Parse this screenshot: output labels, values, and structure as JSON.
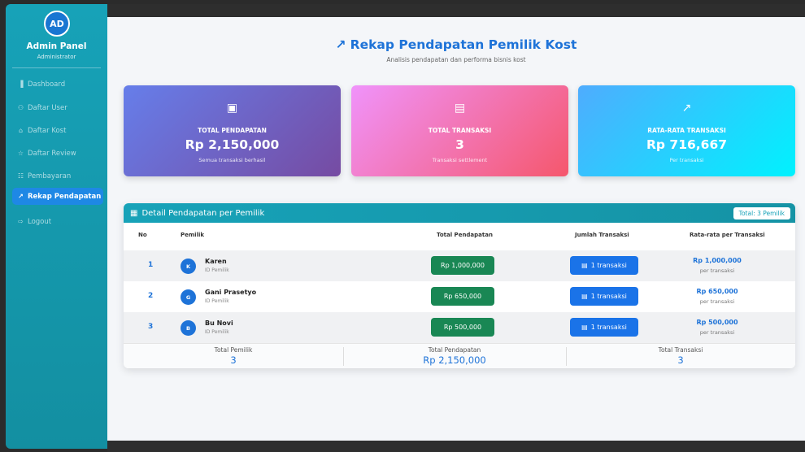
{
  "sidebar": {
    "avatar": "AD",
    "title": "Admin Panel",
    "subtitle": "Administrator",
    "items": [
      {
        "icon": "bar-chart-icon",
        "glyph": "▐",
        "label": "Dashboard"
      },
      {
        "icon": "users-icon",
        "glyph": "⚇",
        "label": "Daftar User"
      },
      {
        "icon": "home-icon",
        "glyph": "⌂",
        "label": "Daftar Kost"
      },
      {
        "icon": "star-icon",
        "glyph": "☆",
        "label": "Daftar Review"
      },
      {
        "icon": "receipt-icon",
        "glyph": "☷",
        "label": "Pembayaran"
      },
      {
        "icon": "line-chart-icon",
        "glyph": "↗",
        "label": "Rekap Pendapatan"
      },
      {
        "icon": "logout-icon",
        "glyph": "⇨",
        "label": "Logout"
      }
    ]
  },
  "header": {
    "icon": "↗",
    "title": "Rekap Pendapatan Pemilik Kost",
    "subtitle": "Analisis pendapatan dan performa bisnis kost"
  },
  "stats": [
    {
      "icon": "cash-icon",
      "glyph": "▣",
      "label": "TOTAL PENDAPATAN",
      "value": "Rp 2,150,000",
      "note": "Semua transaksi berhasil"
    },
    {
      "icon": "receipt-icon",
      "glyph": "▤",
      "label": "TOTAL TRANSAKSI",
      "value": "3",
      "note": "Transaksi settlement"
    },
    {
      "icon": "graph-icon",
      "glyph": "↗",
      "label": "RATA-RATA TRANSAKSI",
      "value": "Rp 716,667",
      "note": "Per transaksi"
    }
  ],
  "table": {
    "title": "Detail Pendapatan per Pemilik",
    "badge": "Total: 3 Pemilik",
    "columns": [
      "No",
      "Pemilik",
      "Total Pendapatan",
      "Jumlah Transaksi",
      "Rata-rata per Transaksi"
    ],
    "rows": [
      {
        "no": "1",
        "initial": "K",
        "name": "Karen",
        "id_label": "ID Pemilik",
        "total": "Rp 1,000,000",
        "transactions": "1 transaksi",
        "avg": "Rp 1,000,000",
        "avg_note": "per transaksi"
      },
      {
        "no": "2",
        "initial": "G",
        "name": "Gani Prasetyo",
        "id_label": "ID Pemilik",
        "total": "Rp 650,000",
        "transactions": "1 transaksi",
        "avg": "Rp 650,000",
        "avg_note": "per transaksi"
      },
      {
        "no": "3",
        "initial": "B",
        "name": "Bu Novi",
        "id_label": "ID Pemilik",
        "total": "Rp 500,000",
        "transactions": "1 transaksi",
        "avg": "Rp 500,000",
        "avg_note": "per transaksi"
      }
    ],
    "summary": [
      {
        "label": "Total Pemilik",
        "value": "3"
      },
      {
        "label": "Total Pendapatan",
        "value": "Rp 2,150,000"
      },
      {
        "label": "Total Transaksi",
        "value": "3"
      }
    ]
  },
  "colors": {
    "sidebar": "#17a2b8",
    "accent": "#1e73d8",
    "success": "#198754",
    "primary_button": "#1a73e8"
  }
}
